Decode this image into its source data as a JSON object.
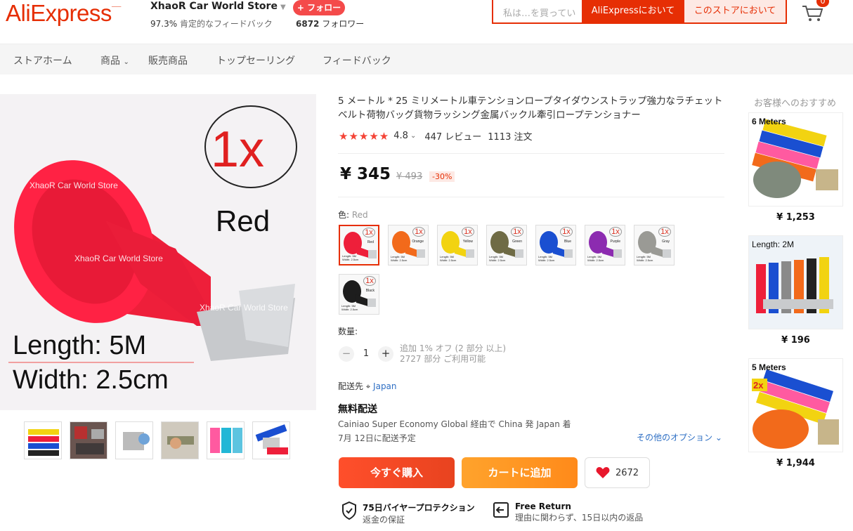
{
  "header": {
    "logo": "AliExpress",
    "store_name": "XhaoR Car World Store",
    "feedback_pct": "97.3%",
    "feedback_label": "肯定的なフィードバック",
    "follow_label": "+ フォロー",
    "followers_count": "6872",
    "followers_label": "フォロワー",
    "search_placeholder": "私は…を買ってい",
    "search_all": "AliExpressにおいて",
    "search_store": "このストアにおいて",
    "cart_count": "0"
  },
  "nav": [
    "ストアホーム",
    "商品",
    "販売商品",
    "トップセーリング",
    "フィードバック"
  ],
  "main_image": {
    "badge": "1x",
    "color_text": "Red",
    "watermark": "XhaoR Car World Store",
    "length": "Length: 5M",
    "width": "Width: 2.5cm"
  },
  "product": {
    "title": "5 メートル * 25 ミリメートル車テンションロープタイダウンストラップ強力なラチェットベルト荷物バッグ貨物ラッシング金属バックル牽引ロープテンショナー",
    "stars": "★★★★★",
    "rating": "4.8",
    "reviews": "447 レビュー",
    "orders": "1113 注文",
    "price": "¥ 345",
    "old_price": "¥ 493",
    "discount": "-30%"
  },
  "color": {
    "label": "色:",
    "selected": "Red",
    "swatch_badge": "1x",
    "swatch_dims": [
      "Length: 5M",
      "Width: 2.5cm"
    ],
    "options": [
      {
        "name": "Red",
        "hex": "#ee1f3a"
      },
      {
        "name": "Orange",
        "hex": "#f26a1b"
      },
      {
        "name": "Yellow",
        "hex": "#f2d311"
      },
      {
        "name": "Green",
        "hex": "#6f6b45"
      },
      {
        "name": "Blue",
        "hex": "#1a4fd1"
      },
      {
        "name": "Purple",
        "hex": "#8c2bb0"
      },
      {
        "name": "Gray",
        "hex": "#9a9a95"
      },
      {
        "name": "Black",
        "hex": "#1d1d1d"
      }
    ]
  },
  "quantity": {
    "label": "数量:",
    "value": "1",
    "minus": "−",
    "plus": "+",
    "note1": "追加 1% オフ (2 部分 以上)",
    "note2": "2727 部分 ご利用可能"
  },
  "shipping": {
    "label": "配送先",
    "country": "Japan",
    "free": "無料配送",
    "via": "Cainiao Super Economy Global 経由で China 発 Japan 着",
    "eta": "7月 12日に配送予定",
    "more": "その他のオプション"
  },
  "actions": {
    "buy_now": "今すぐ購入",
    "add_cart": "カートに追加",
    "wishlist_count": "2672"
  },
  "protection": [
    {
      "title": "75日バイヤープロテクション",
      "sub": "返金の保証"
    },
    {
      "title": "Free Return",
      "sub": "理由に関わらず、15日以内の返品"
    }
  ],
  "recommend": {
    "title": "お客様へのおすすめ",
    "items": [
      {
        "label": "6 Meters",
        "price": "¥ 1,253"
      },
      {
        "label": "Length: 2M",
        "price": "¥ 196"
      },
      {
        "label": "5 Meters",
        "badge": "2x",
        "price": "¥ 1,944"
      }
    ]
  },
  "colors": {
    "accent": "#e62e04",
    "buy": "#ff4f2b",
    "cart": "#ff9a22",
    "link": "#2e6fc4"
  }
}
